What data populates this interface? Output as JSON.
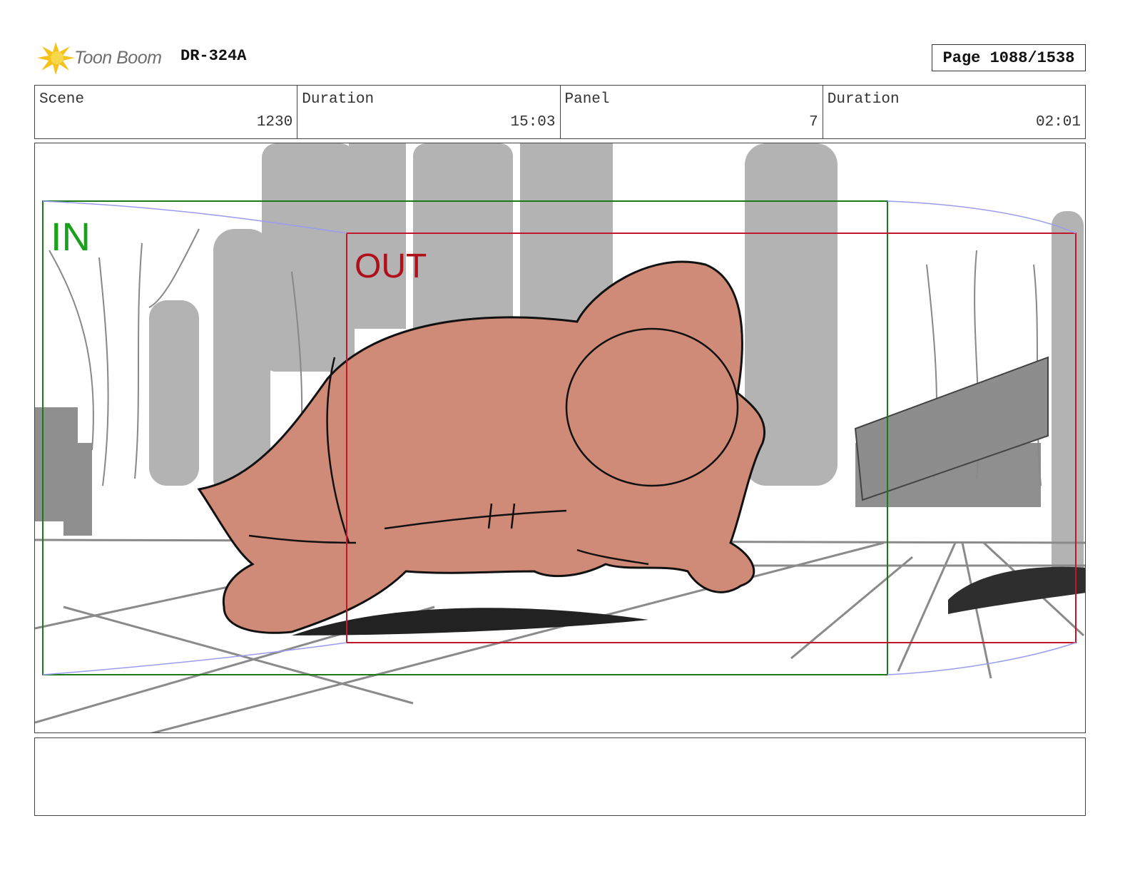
{
  "header": {
    "logo_text": "Toon Boom",
    "production_code": "DR-324A",
    "page_label": "Page 1088/1538"
  },
  "info": {
    "scene_label": "Scene",
    "scene_value": "1230",
    "scene_duration_label": "Duration",
    "scene_duration_value": "15:03",
    "panel_label": "Panel",
    "panel_value": "7",
    "panel_duration_label": "Duration",
    "panel_duration_value": "02:01"
  },
  "panel": {
    "in_label": "IN",
    "out_label": "OUT",
    "in_color": "#1aa01a",
    "out_color": "#b0101a",
    "character_color": "#d08a78"
  },
  "notes": {
    "text": ""
  }
}
